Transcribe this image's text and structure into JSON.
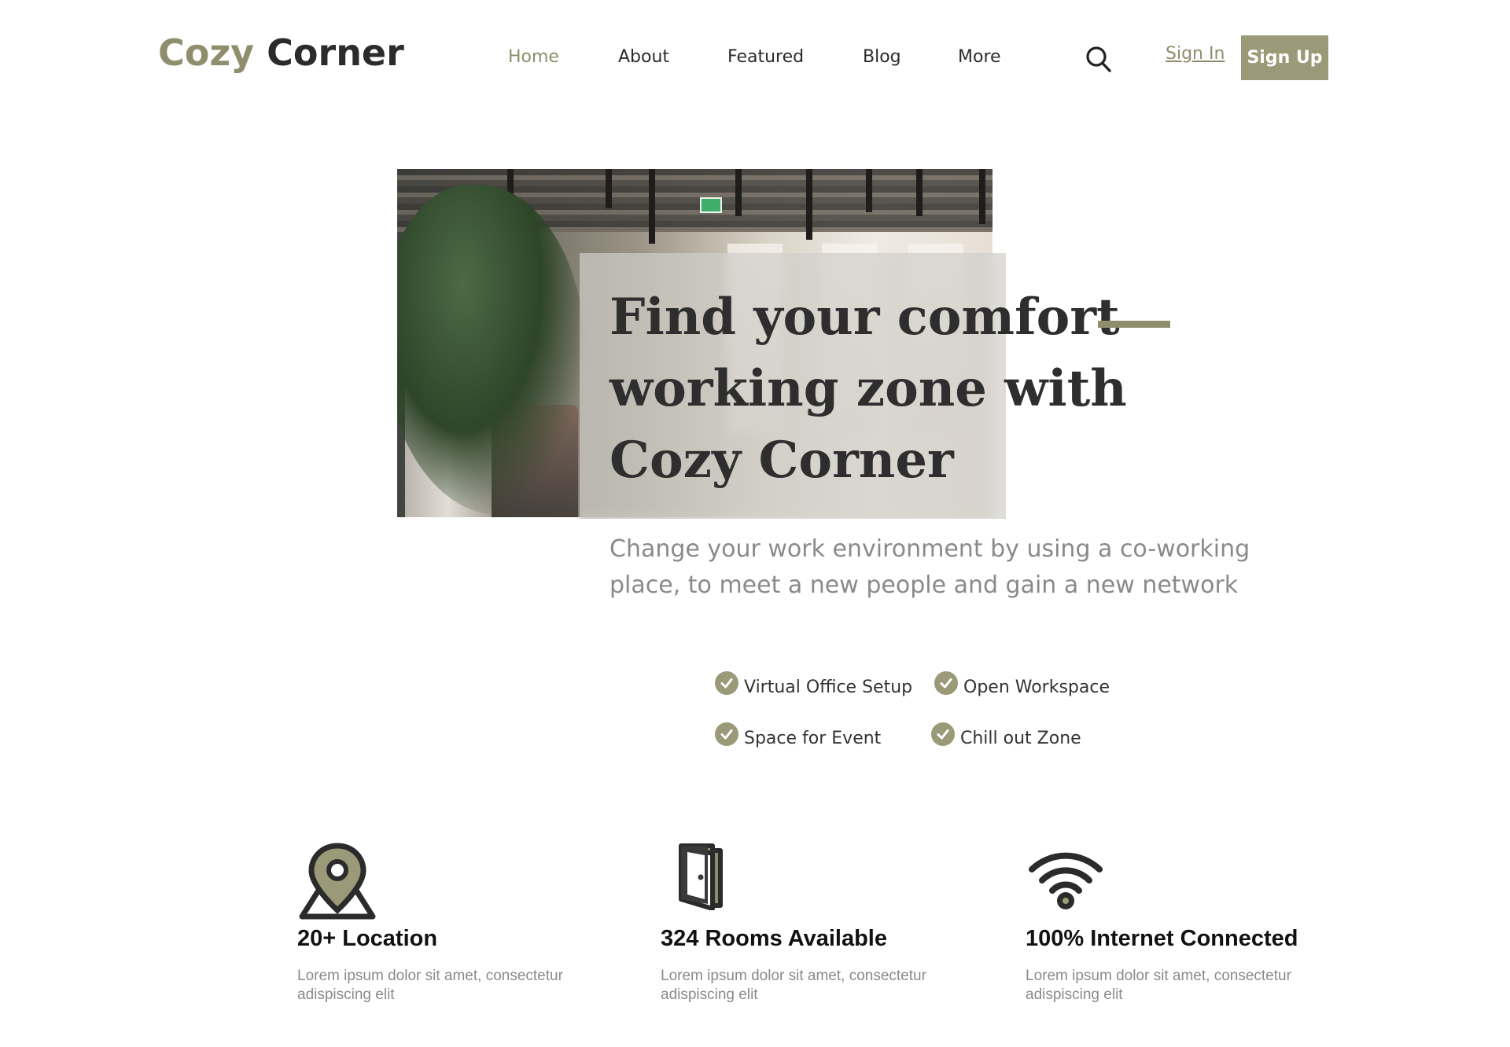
{
  "header": {
    "logo_part1": "Cozy",
    "logo_part2": "Corner",
    "nav": [
      {
        "label": "Home",
        "active": true
      },
      {
        "label": "About",
        "active": false
      },
      {
        "label": "Featured",
        "active": false
      },
      {
        "label": "Blog",
        "active": false
      },
      {
        "label": "More",
        "active": false
      }
    ],
    "search_icon": "search-icon",
    "sign_in": "Sign In",
    "sign_up": "Sign Up"
  },
  "hero": {
    "title_lines": [
      "Find your comfort",
      "working zone with",
      "Cozy Corner"
    ],
    "subtitle_lines": [
      "Change your work environment by using a co-working",
      "place, to meet a new people and gain a new network"
    ]
  },
  "features": [
    {
      "label": "Virtual Office Setup",
      "icon": "check-circle-icon"
    },
    {
      "label": "Open Workspace",
      "icon": "check-circle-icon"
    },
    {
      "label": "Space for Event",
      "icon": "check-circle-icon"
    },
    {
      "label": "Chill out Zone",
      "icon": "check-circle-icon"
    }
  ],
  "stats": [
    {
      "icon": "location-pin-icon",
      "title": "20+ Location",
      "description": "Lorem ipsum dolor sit amet, consectetur adispiscing elit"
    },
    {
      "icon": "door-icon",
      "title": "324 Rooms Available",
      "description": "Lorem ipsum dolor sit amet, consectetur adispiscing elit"
    },
    {
      "icon": "wifi-icon",
      "title": "100% Internet Connected",
      "description": "Lorem ipsum dolor sit amet, consectetur adispiscing elit"
    }
  ],
  "colors": {
    "accent": "#8f8e6c",
    "button": "#9b9a78",
    "text_dark": "#2b2b2b",
    "text_muted": "#8a8a8a"
  }
}
